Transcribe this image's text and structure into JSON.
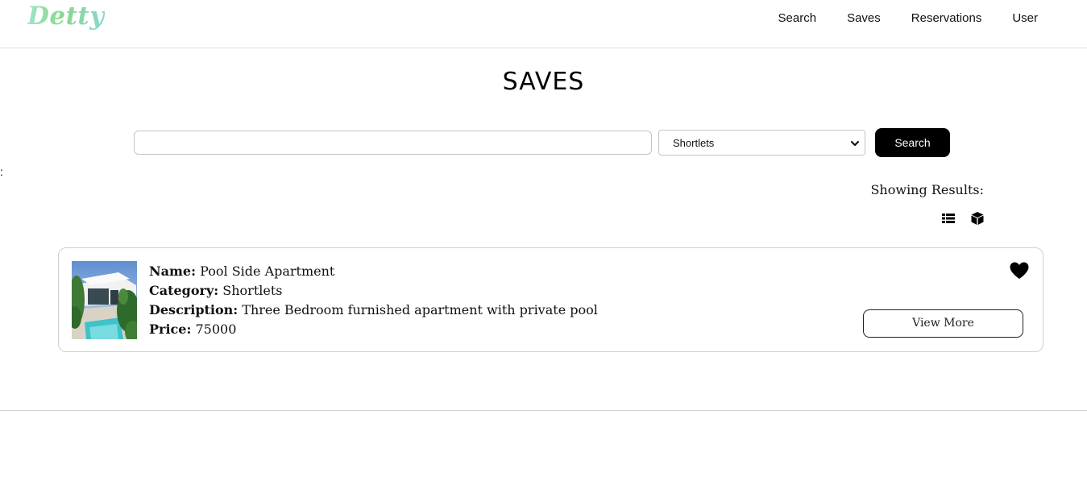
{
  "header": {
    "logo": "Detty",
    "nav": [
      "Search",
      "Saves",
      "Reservations",
      "User"
    ]
  },
  "page": {
    "title": "SAVES",
    "colon": ":"
  },
  "search": {
    "input_value": "",
    "select_value": "Shortlets",
    "button_label": "Search"
  },
  "results": {
    "showing_label": "Showing Results:",
    "view_icons": [
      "list-view-icon",
      "cube-view-icon"
    ],
    "items": [
      {
        "name_label": "Name:",
        "name": "Pool Side Apartment",
        "category_label": "Category:",
        "category": "Shortlets",
        "description_label": "Description:",
        "description": "Three Bedroom furnished apartment with private pool",
        "price_label": "Price:",
        "price": "75000",
        "view_more_label": "View More",
        "saved_icon": "heart-icon"
      }
    ]
  },
  "colors": {
    "logo_gradient": [
      "#9fe3c9",
      "#86d98a",
      "#8ad7d0"
    ],
    "button_bg": "#000000",
    "button_text": "#ffffff",
    "border": "#cfcfcf"
  }
}
